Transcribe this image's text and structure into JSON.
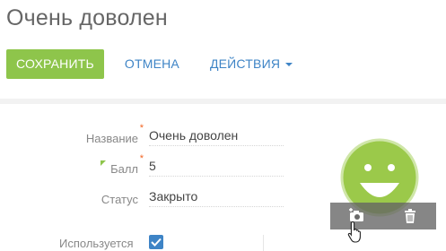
{
  "page": {
    "title": "Очень доволен"
  },
  "toolbar": {
    "save_label": "СОХРАНИТЬ",
    "cancel_label": "ОТМЕНА",
    "actions_label": "ДЕЙСТВИЯ"
  },
  "form": {
    "name": {
      "label": "Название",
      "value": "Очень доволен",
      "required": true
    },
    "score": {
      "label": "Балл",
      "value": "5",
      "required": true
    },
    "status": {
      "label": "Статус",
      "value": "Закрыто"
    },
    "in_use": {
      "label": "Используется",
      "checked": true
    }
  },
  "image": {
    "face_icon": "smiley-face-icon",
    "upload_icon": "camera-plus-icon",
    "delete_icon": "trash-icon",
    "face_color": "#9bc94a"
  },
  "colors": {
    "accent_green": "#8ec54b",
    "link_blue": "#3e84c6",
    "required_orange": "#f26522"
  }
}
